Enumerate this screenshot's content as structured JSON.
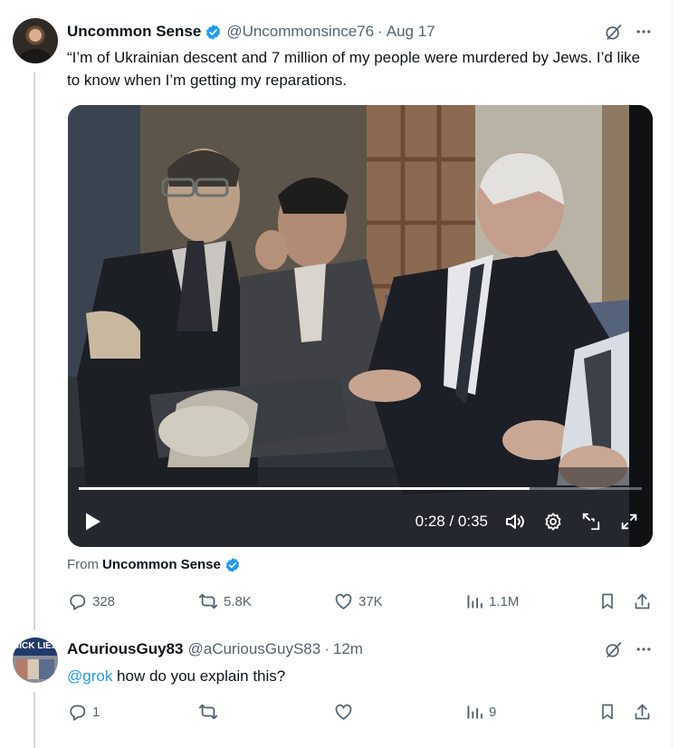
{
  "tweet": {
    "author_name": "Uncommon Sense",
    "handle": "@Uncommonsince76",
    "separator": "·",
    "date": "Aug 17",
    "text": "“I’m of Ukrainian descent and 7 million of my people were murdered by Jews. I’d like to know when I’m getting my reparations.",
    "video": {
      "elapsed": "0:28",
      "duration": "0:35",
      "time_separator": " / ",
      "progress": 0.8
    },
    "from_label": "From",
    "from_name": "Uncommon Sense",
    "stats": {
      "replies": "328",
      "reposts": "5.8K",
      "likes": "37K",
      "views": "1.1M"
    }
  },
  "reply": {
    "author_name": "ACuriousGuy83",
    "handle": "@aCuriousGuyS83",
    "separator": "·",
    "time": "12m",
    "avatar_text": "SICK LIES",
    "mention": "@grok",
    "text": " how do you explain this?",
    "stats": {
      "replies": "1",
      "views": "9"
    }
  },
  "colors": {
    "accent": "#1d9bf0",
    "secondary_text": "#536471",
    "thread_line": "#cfd9de"
  },
  "icons": [
    "verified-badge-icon",
    "grok-icon",
    "more-icon",
    "play-icon",
    "volume-icon",
    "settings-icon",
    "minimize-icon",
    "fullscreen-icon",
    "reply-icon",
    "repost-icon",
    "like-icon",
    "views-icon",
    "bookmark-icon",
    "share-icon"
  ]
}
